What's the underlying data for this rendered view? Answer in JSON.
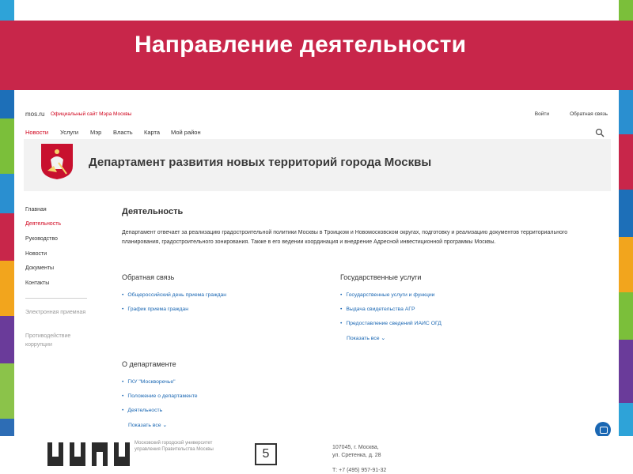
{
  "slide": {
    "title": "Направление деятельности",
    "page_number": "5",
    "colors": {
      "banner": "#c8264a",
      "link": "#1a67b3",
      "active": "#d0021b"
    }
  },
  "site": {
    "brand": "mos.ru",
    "brand_subtitle": "Официальный сайт Мэра Москвы",
    "login": "Войти",
    "feedback": "Обратная связь",
    "nav": [
      "Новости",
      "Услуги",
      "Мэр",
      "Власть",
      "Карта",
      "Мой район"
    ],
    "search_icon": "search-icon",
    "department_title": "Департамент развития новых территорий города Москвы",
    "crest_icon": "moscow-crest-icon"
  },
  "sidebar": {
    "items": [
      "Главная",
      "Деятельность",
      "Руководство",
      "Новости",
      "Документы",
      "Контакты"
    ],
    "muted": [
      "Электронная приемная",
      "Противодействие коррупции"
    ]
  },
  "main": {
    "heading": "Деятельность",
    "description": "Департамент отвечает за реализацию градостроительной политики Москвы в Троицком и Новомосковском округах, подготовку и реализацию документов территориального планирования, градостроительного зонирования. Также в его ведении координация и внедрение Адресной инвестиционной программы Москвы.",
    "feedback_block": {
      "title": "Обратная связь",
      "links": [
        "Общероссийский день приема граждан",
        "График приема граждан"
      ]
    },
    "services_block": {
      "title": "Государственные услуги",
      "links": [
        "Государственные услуги и функции",
        "Выдача свидетельства АГР",
        "Предоставление сведений ИАИС ОГД"
      ],
      "more": "Показать все ⌄"
    },
    "about_block": {
      "title": "О департаменте",
      "links": [
        "ГКУ \"Москворечье\"",
        "Положение о департаменте",
        "Деятельность"
      ],
      "more": "Показать все ⌄"
    }
  },
  "footer": {
    "university_text": "Московский городской университет управления Правительства Москвы",
    "address_line1": "107045, г. Москва,",
    "address_line2": "ул. Сретенка, д. 28",
    "phone": "Т: +7 (495) 957-91-32"
  }
}
